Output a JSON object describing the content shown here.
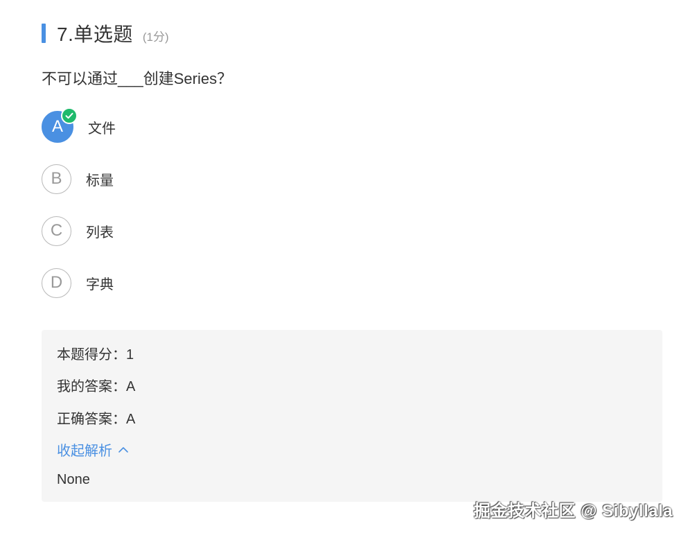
{
  "question": {
    "title": "7.单选题",
    "score": "(1分)",
    "text": "不可以通过___创建Series？"
  },
  "options": [
    {
      "letter": "A",
      "label": "文件",
      "selected": true,
      "correct": true
    },
    {
      "letter": "B",
      "label": "标量",
      "selected": false
    },
    {
      "letter": "C",
      "label": "列表",
      "selected": false
    },
    {
      "letter": "D",
      "label": "字典",
      "selected": false
    }
  ],
  "analysis": {
    "score_line": "本题得分：1",
    "my_answer_line": "我的答案：A",
    "correct_answer_line": "正确答案：A",
    "toggle_label": "收起解析",
    "content": "None"
  },
  "watermark": "掘金技术社区 @ Sibyllala",
  "colors": {
    "accent": "#4a90e2",
    "correct": "#1fba6c",
    "panel_bg": "#f5f5f5",
    "muted": "#999999"
  }
}
